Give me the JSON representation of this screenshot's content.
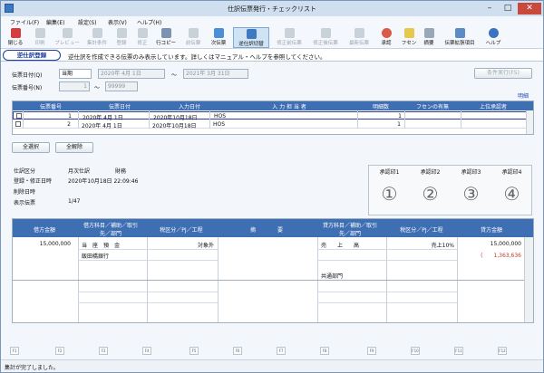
{
  "window": {
    "title": "仕訳伝票発行・チェックリスト"
  },
  "menu": [
    "ファイル(F)",
    "編集(E)",
    "設定(S)",
    "表示(V)",
    "ヘルプ(H)"
  ],
  "toolbar": {
    "items": [
      {
        "label": "閉じる",
        "icon": "close-icon"
      },
      {
        "label": "印刷",
        "icon": "print-icon"
      },
      {
        "label": "プレビュー",
        "icon": "preview-icon"
      },
      {
        "label": "集計条件",
        "icon": "filter-icon"
      },
      {
        "label": "登録",
        "icon": "register-icon"
      },
      {
        "label": "修正",
        "icon": "edit-icon"
      },
      {
        "label": "行コピー",
        "icon": "copy-icon"
      },
      {
        "label": "前伝票",
        "icon": "prev-icon"
      },
      {
        "label": "次伝票",
        "icon": "next-icon"
      },
      {
        "label": "逆仕訳切替",
        "icon": "reverse-icon"
      },
      {
        "label": "修正前伝票",
        "icon": "before-edit-icon"
      },
      {
        "label": "修正後伝票",
        "icon": "after-edit-icon"
      },
      {
        "label": "最新伝票",
        "icon": "latest-icon"
      },
      {
        "label": "承認",
        "icon": "approve-icon"
      },
      {
        "label": "フセン",
        "icon": "sticky-note-icon"
      },
      {
        "label": "摘要",
        "icon": "summary-icon"
      },
      {
        "label": "伝票拡張項目",
        "icon": "extension-icon"
      },
      {
        "label": "ヘルプ",
        "icon": "help-icon"
      }
    ]
  },
  "mode_label": "逆仕訳登録",
  "message": "逆仕訳を作成できる伝票のみ表示しています。詳しくはマニュアル・ヘルプを参照してください。",
  "filter": {
    "date_label": "伝票日付(Q)",
    "date_type": "当期",
    "date_from": "2020年  4月  1日",
    "date_sep": "～",
    "date_to": "2021年  3月 31日",
    "number_label": "伝票番号(N)",
    "number_from": "1",
    "number_sep": "～",
    "number_to": "99999",
    "search_button": "条件実行(F5)"
  },
  "detail_link": "明細",
  "list": {
    "headers": [
      "伝票番号",
      "伝票日付",
      "入力日付",
      "入 力 担 当 者",
      "明細数",
      "フセンの有無",
      "上位承認者"
    ],
    "rows": [
      {
        "no": "1",
        "date": "2020年 4月 1日",
        "input_date": "2020年10月18日",
        "user": "HOS",
        "lines": "1",
        "sticky": "",
        "approver": ""
      },
      {
        "no": "2",
        "date": "2020年 4月 1日",
        "input_date": "2020年10月18日",
        "user": "HOS",
        "lines": "1",
        "sticky": "",
        "approver": ""
      }
    ]
  },
  "buttons": {
    "select_all": "全選択",
    "deselect_all": "全解除"
  },
  "info": {
    "labels": [
      "仕訳区分",
      "登録・修正日時",
      "削除日時",
      "表示伝票"
    ],
    "values": [
      "月次仕訳",
      "2020年10月18日 22:09:46",
      "",
      "1/47"
    ],
    "extra": "財務"
  },
  "stamps": {
    "headers": [
      "承認印1",
      "承認印2",
      "承認印3",
      "承認印4"
    ],
    "marks": [
      "①",
      "②",
      "③",
      "④"
    ]
  },
  "journal": {
    "headers": {
      "debit_amount": "借方金額",
      "debit_account": "借方科目／補助／取引先／部門",
      "debit_tax": "税区分／PJ／工程",
      "summary": "摘　　　　要",
      "credit_account": "貸方科目／補助／取引先／部門",
      "credit_tax": "税区分／PJ／工程",
      "credit_amount": "貸方金額"
    },
    "debit_amount": "15,000,000",
    "debit_account": "当　座　預　金",
    "debit_sub": "飯田橋銀行",
    "debit_tax": "対象外",
    "credit_account": "売　　上　　高",
    "credit_tax": "売上10%",
    "credit_amount": "15,000,000",
    "credit_tax_amount": "(　　1,363,636",
    "credit_dept": "共通部門"
  },
  "fkeys": [
    "F1",
    "F2",
    "F3",
    "F4",
    "F5",
    "F6",
    "F7",
    "F8",
    "F9",
    "F10",
    "F11",
    "F12"
  ],
  "status": "集計が完了しました。"
}
